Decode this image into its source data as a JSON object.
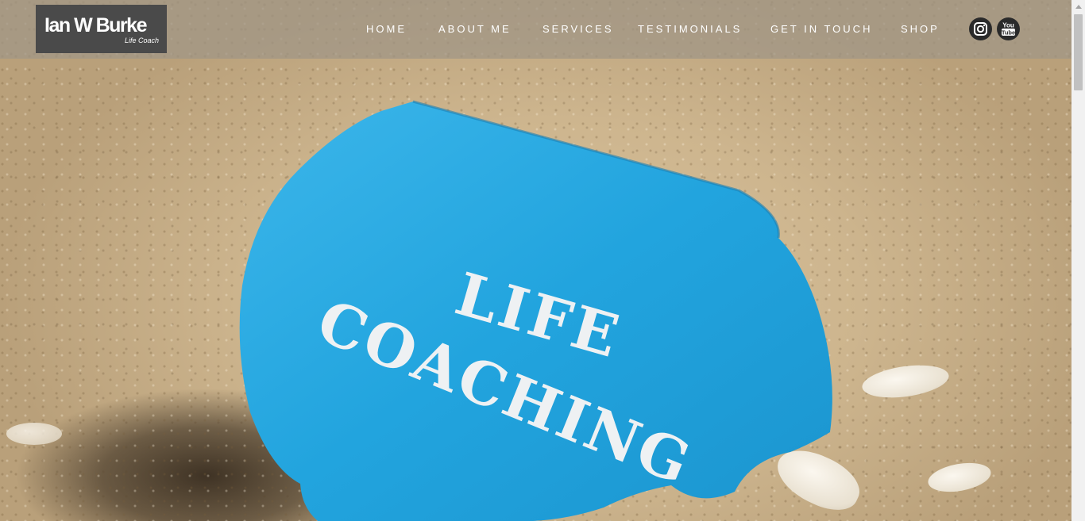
{
  "logo": {
    "name": "Ian W Burke",
    "subtitle": "Life Coach"
  },
  "nav": {
    "items": [
      {
        "label": "HOME"
      },
      {
        "label": "ABOUT ME"
      },
      {
        "label": "SERVICES"
      },
      {
        "label": "TESTIMONIALS"
      },
      {
        "label": "GET IN TOUCH"
      },
      {
        "label": "SHOP"
      }
    ]
  },
  "social": [
    {
      "icon": "instagram-icon"
    },
    {
      "icon": "youtube-icon",
      "text": "You Tube"
    }
  ],
  "hero": {
    "sign_line1": "LIFE",
    "sign_line2": "COACHING",
    "sign_color": "#2aa9e0",
    "text_color": "#eef1f3"
  },
  "colors": {
    "header_bg": "rgba(160,150,135,0.72)",
    "logo_bg": "#4a4a4a"
  }
}
